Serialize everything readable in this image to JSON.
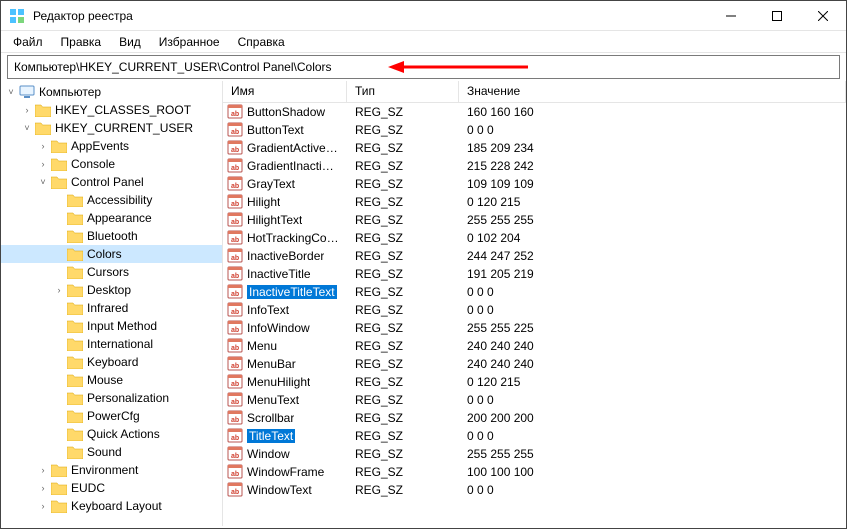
{
  "window": {
    "title": "Редактор реестра"
  },
  "menu": {
    "file": "Файл",
    "edit": "Правка",
    "view": "Вид",
    "favorites": "Избранное",
    "help": "Справка"
  },
  "address": {
    "path": "Компьютер\\HKEY_CURRENT_USER\\Control Panel\\Colors"
  },
  "columns": {
    "name": "Имя",
    "type": "Тип",
    "value": "Значение"
  },
  "tree": {
    "root": "Компьютер",
    "hkcr": "HKEY_CLASSES_ROOT",
    "hkcu": "HKEY_CURRENT_USER",
    "cp_items": [
      "AppEvents",
      "Console",
      "Control Panel"
    ],
    "control_panel_children": [
      "Accessibility",
      "Appearance",
      "Bluetooth",
      "Colors",
      "Cursors",
      "Desktop",
      "Infrared",
      "Input Method",
      "International",
      "Keyboard",
      "Mouse",
      "Personalization",
      "PowerCfg",
      "Quick Actions",
      "Sound"
    ],
    "after_cp": [
      "Environment",
      "EUDC",
      "Keyboard Layout"
    ],
    "selected": "Colors"
  },
  "rows": [
    {
      "name": "ButtonShadow",
      "type": "REG_SZ",
      "value": "160 160 160",
      "sel": false
    },
    {
      "name": "ButtonText",
      "type": "REG_SZ",
      "value": "0 0 0",
      "sel": false
    },
    {
      "name": "GradientActiveT…",
      "type": "REG_SZ",
      "value": "185 209 234",
      "sel": false
    },
    {
      "name": "GradientInactive…",
      "type": "REG_SZ",
      "value": "215 228 242",
      "sel": false
    },
    {
      "name": "GrayText",
      "type": "REG_SZ",
      "value": "109 109 109",
      "sel": false
    },
    {
      "name": "Hilight",
      "type": "REG_SZ",
      "value": "0 120 215",
      "sel": false
    },
    {
      "name": "HilightText",
      "type": "REG_SZ",
      "value": "255 255 255",
      "sel": false
    },
    {
      "name": "HotTrackingColor",
      "type": "REG_SZ",
      "value": "0 102 204",
      "sel": false
    },
    {
      "name": "InactiveBorder",
      "type": "REG_SZ",
      "value": "244 247 252",
      "sel": false
    },
    {
      "name": "InactiveTitle",
      "type": "REG_SZ",
      "value": "191 205 219",
      "sel": false
    },
    {
      "name": "InactiveTitleText",
      "type": "REG_SZ",
      "value": "0 0 0",
      "sel": true
    },
    {
      "name": "InfoText",
      "type": "REG_SZ",
      "value": "0 0 0",
      "sel": false
    },
    {
      "name": "InfoWindow",
      "type": "REG_SZ",
      "value": "255 255 225",
      "sel": false
    },
    {
      "name": "Menu",
      "type": "REG_SZ",
      "value": "240 240 240",
      "sel": false
    },
    {
      "name": "MenuBar",
      "type": "REG_SZ",
      "value": "240 240 240",
      "sel": false
    },
    {
      "name": "MenuHilight",
      "type": "REG_SZ",
      "value": "0 120 215",
      "sel": false
    },
    {
      "name": "MenuText",
      "type": "REG_SZ",
      "value": "0 0 0",
      "sel": false
    },
    {
      "name": "Scrollbar",
      "type": "REG_SZ",
      "value": "200 200 200",
      "sel": false
    },
    {
      "name": "TitleText",
      "type": "REG_SZ",
      "value": "0 0 0",
      "sel": true
    },
    {
      "name": "Window",
      "type": "REG_SZ",
      "value": "255 255 255",
      "sel": false
    },
    {
      "name": "WindowFrame",
      "type": "REG_SZ",
      "value": "100 100 100",
      "sel": false
    },
    {
      "name": "WindowText",
      "type": "REG_SZ",
      "value": "0 0 0",
      "sel": false
    }
  ]
}
